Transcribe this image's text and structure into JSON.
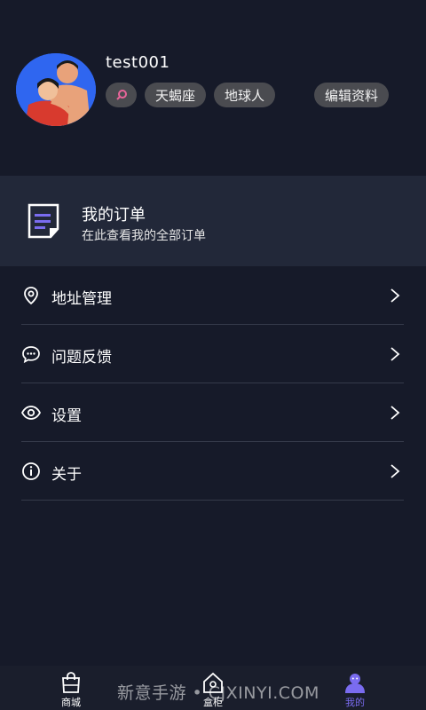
{
  "profile": {
    "username": "test001",
    "tags": {
      "gender_icon": "female-symbol-icon",
      "zodiac": "天蝎座",
      "region": "地球人"
    },
    "edit_label": "编辑资料"
  },
  "order": {
    "icon": "document-list-icon",
    "title": "我的订单",
    "subtitle": "在此查看我的全部订单"
  },
  "menu": [
    {
      "icon": "location-pin-icon",
      "label": "地址管理"
    },
    {
      "icon": "chat-bubble-icon",
      "label": "问题反馈"
    },
    {
      "icon": "eye-icon",
      "label": "设置"
    },
    {
      "icon": "info-icon",
      "label": "关于"
    }
  ],
  "tabbar": {
    "items": [
      {
        "icon": "shopping-bag-icon",
        "label": "商城"
      },
      {
        "icon": "house-box-icon",
        "label": "盒柜"
      },
      {
        "icon": "person-icon",
        "label": "我的"
      }
    ],
    "active_color": "#7a6cf0"
  },
  "watermark": "新意手游 • CJXINYI.COM",
  "colors": {
    "background": "#161a29",
    "card": "#222839",
    "tag": "#4a4b50",
    "accent": "#7a6cf0",
    "avatar_bg": "#2f66f0"
  }
}
